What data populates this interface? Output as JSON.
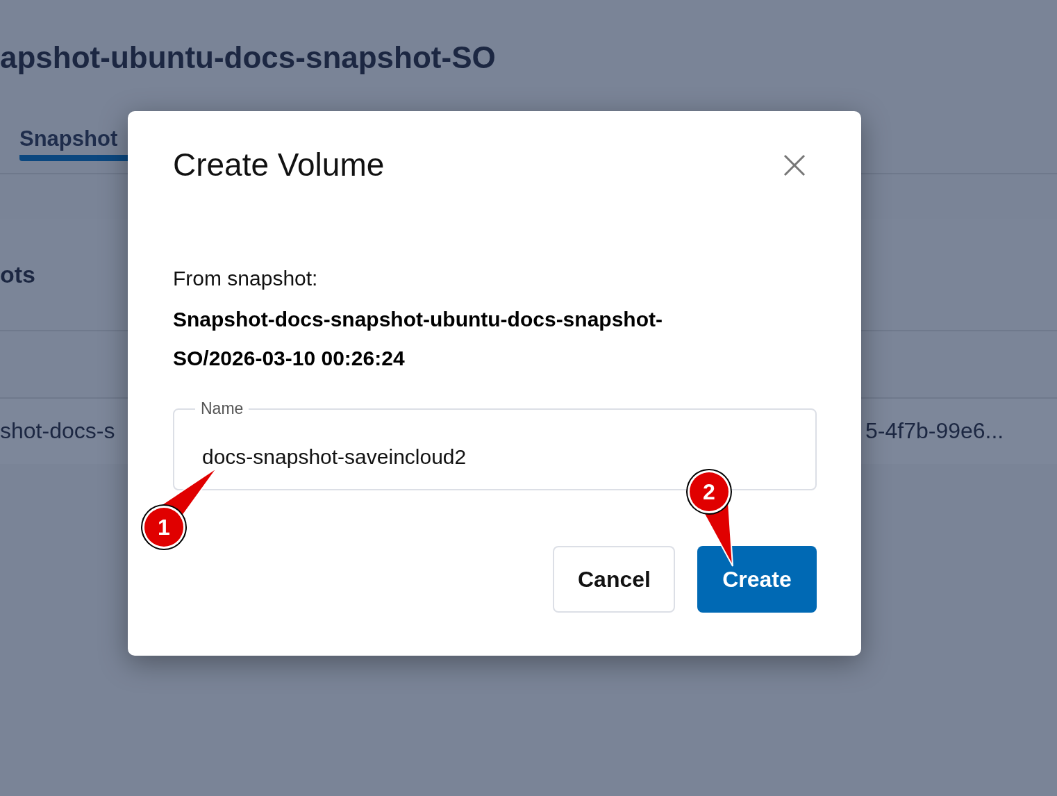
{
  "page": {
    "title": "apshot-ubuntu-docs-snapshot-SO",
    "tabs": [
      {
        "label": "Snapshot",
        "selected": true
      }
    ],
    "section_title": "ots",
    "row": [
      "shot-docs-s",
      "5-4f7b-99e6..."
    ]
  },
  "dialog": {
    "title": "Create Volume",
    "source_label": "From snapshot:",
    "source_name": "Snapshot-docs-snapshot-ubuntu-docs-snapshot-SO/2026-03-10 00:26:24",
    "field": {
      "label": "Name",
      "value": "docs-snapshot-saveincloud2"
    },
    "buttons": [
      {
        "label": "Cancel",
        "kind": "secondary"
      },
      {
        "label": "Create",
        "kind": "primary"
      }
    ]
  },
  "callouts": [
    {
      "number": "1"
    },
    {
      "number": "2"
    }
  ]
}
